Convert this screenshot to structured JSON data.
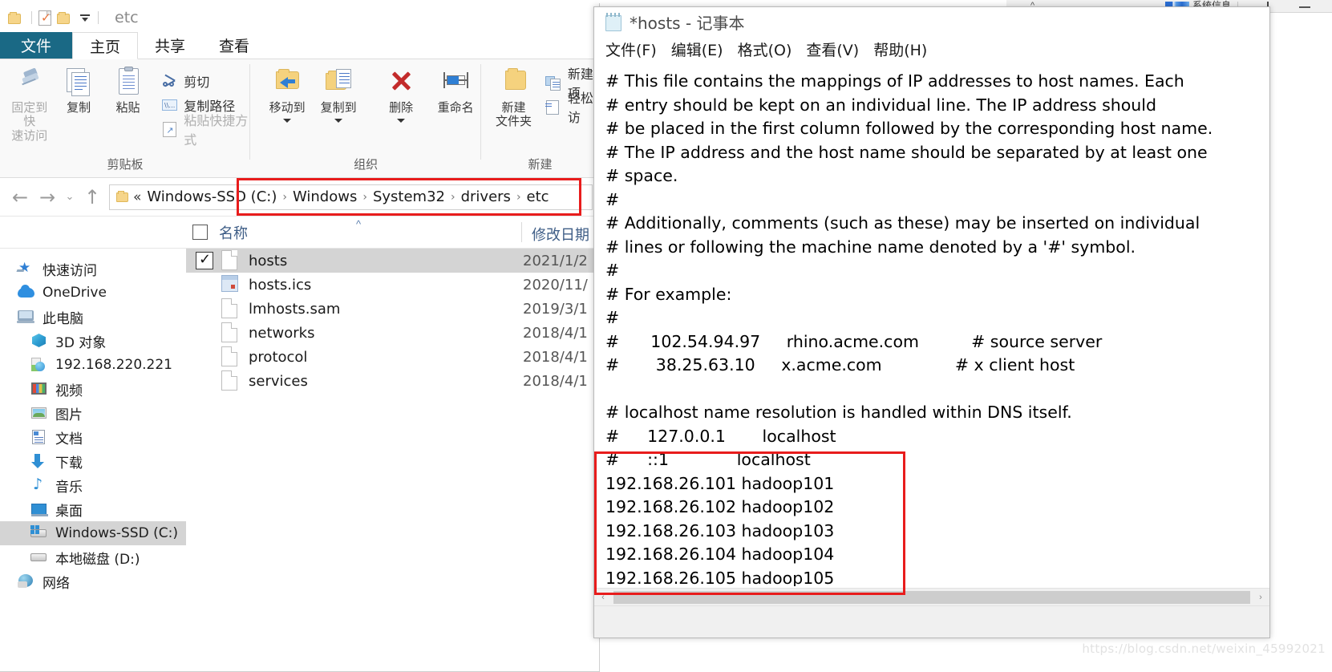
{
  "background_window": {
    "label": "系统信息"
  },
  "explorer": {
    "quick_access_toolbar": {
      "title": "etc",
      "buttons": [
        "folder-icon",
        "properties-icon",
        "new-folder-icon",
        "customize-caret"
      ]
    },
    "ribbon_tabs": [
      {
        "label": "文件",
        "active": false,
        "file_tab": true
      },
      {
        "label": "主页",
        "active": true
      },
      {
        "label": "共享",
        "active": false
      },
      {
        "label": "查看",
        "active": false
      }
    ],
    "ribbon_groups": [
      {
        "name": "剪贴板",
        "big_buttons": [
          {
            "label": "固定到快\n速访问",
            "icon": "pin-icon",
            "disabled": true
          },
          {
            "label": "复制",
            "icon": "copy-icon",
            "disabled": false
          },
          {
            "label": "粘贴",
            "icon": "paste-icon",
            "disabled": false
          }
        ],
        "small_buttons": [
          {
            "label": "剪切",
            "icon": "scissors-icon",
            "disabled": false
          },
          {
            "label": "复制路径",
            "icon": "copy-path-icon",
            "disabled": false
          },
          {
            "label": "粘贴快捷方式",
            "icon": "paste-shortcut-icon",
            "disabled": true
          }
        ]
      },
      {
        "name": "组织",
        "big_buttons": [
          {
            "label": "移动到",
            "icon": "move-to-icon",
            "has_caret": true
          },
          {
            "label": "复制到",
            "icon": "copy-to-icon",
            "has_caret": true
          },
          {
            "label": "删除",
            "icon": "delete-icon",
            "has_caret": true
          },
          {
            "label": "重命名",
            "icon": "rename-icon",
            "has_caret": false
          }
        ]
      },
      {
        "name": "新建",
        "big_buttons": [
          {
            "label": "新建\n文件夹",
            "icon": "new-folder-icon"
          }
        ],
        "small_buttons": [
          {
            "label": "新建项",
            "icon": "new-item-icon"
          },
          {
            "label": "轻松访",
            "icon": "easy-access-icon"
          }
        ]
      }
    ],
    "address_bar": {
      "back_icon": "←",
      "forward_icon": "→",
      "recent_caret": "⌄",
      "up_icon": "↑",
      "lead": "«",
      "crumbs": [
        "Windows-SSD (C:)",
        "Windows",
        "System32",
        "drivers",
        "etc"
      ],
      "separator": "›"
    },
    "columns": {
      "name": "名称",
      "date_modified": "修改日期"
    },
    "nav_pane": [
      {
        "label": "快速访问",
        "icon": "star-icon",
        "indent": false,
        "selected": false
      },
      {
        "label": "OneDrive",
        "icon": "cloud-icon",
        "indent": false,
        "selected": false
      },
      {
        "label": "此电脑",
        "icon": "pc-icon",
        "indent": false,
        "selected": false
      },
      {
        "label": "3D 对象",
        "icon": "cube-icon",
        "indent": true,
        "selected": false
      },
      {
        "label": "192.168.220.221",
        "icon": "network-location-icon",
        "indent": true,
        "selected": false
      },
      {
        "label": "视频",
        "icon": "video-icon",
        "indent": true,
        "selected": false
      },
      {
        "label": "图片",
        "icon": "pictures-icon",
        "indent": true,
        "selected": false
      },
      {
        "label": "文档",
        "icon": "documents-icon",
        "indent": true,
        "selected": false
      },
      {
        "label": "下载",
        "icon": "downloads-icon",
        "indent": true,
        "selected": false
      },
      {
        "label": "音乐",
        "icon": "music-icon",
        "indent": true,
        "selected": false
      },
      {
        "label": "桌面",
        "icon": "desktop-icon",
        "indent": true,
        "selected": false
      },
      {
        "label": "Windows-SSD (C:)",
        "icon": "windows-drive-icon",
        "indent": true,
        "selected": true
      },
      {
        "label": "本地磁盘 (D:)",
        "icon": "hard-disk-icon",
        "indent": true,
        "selected": false
      },
      {
        "label": "网络",
        "icon": "network-icon",
        "indent": false,
        "selected": false
      }
    ],
    "files": [
      {
        "name": "hosts",
        "date": "2021/1/2",
        "icon": "file-icon",
        "selected": true,
        "checked": true
      },
      {
        "name": "hosts.ics",
        "date": "2020/11/",
        "icon": "ics-file-icon",
        "selected": false,
        "checked": false
      },
      {
        "name": "lmhosts.sam",
        "date": "2019/3/1",
        "icon": "file-icon",
        "selected": false,
        "checked": false
      },
      {
        "name": "networks",
        "date": "2018/4/1",
        "icon": "file-icon",
        "selected": false,
        "checked": false
      },
      {
        "name": "protocol",
        "date": "2018/4/1",
        "icon": "file-icon",
        "selected": false,
        "checked": false
      },
      {
        "name": "services",
        "date": "2018/4/1",
        "icon": "file-icon",
        "selected": false,
        "checked": false
      }
    ]
  },
  "notepad": {
    "title": "*hosts - 记事本",
    "icon": "notepad-icon",
    "menu": [
      "文件(F)",
      "编辑(E)",
      "格式(O)",
      "查看(V)",
      "帮助(H)"
    ],
    "content": "# This file contains the mappings of IP addresses to host names. Each\n# entry should be kept on an individual line. The IP address should\n# be placed in the first column followed by the corresponding host name.\n# The IP address and the host name should be separated by at least one\n# space.\n#\n# Additionally, comments (such as these) may be inserted on individual\n# lines or following the machine name denoted by a '#' symbol.\n#\n# For example:\n#\n#      102.54.94.97     rhino.acme.com          # source server\n#       38.25.63.10     x.acme.com              # x client host\n\n# localhost name resolution is handled within DNS itself.\n#\t127.0.0.1       localhost\n#\t::1             localhost\n192.168.26.101 hadoop101\n192.168.26.102 hadoop102\n192.168.26.103 hadoop103\n192.168.26.104 hadoop104\n192.168.26.105 hadoop105",
    "host_entries": [
      "192.168.26.101 hadoop101",
      "192.168.26.102 hadoop102",
      "192.168.26.103 hadoop103",
      "192.168.26.104 hadoop104",
      "192.168.26.105 hadoop105"
    ],
    "scroll_left_arrow": "‹",
    "scroll_right_arrow": "›"
  },
  "watermark": "https://blog.csdn.net/weixin_45992021",
  "colors": {
    "file_tab": "#1a6985",
    "annotation_red": "#e81c1c",
    "selection_gray": "#d4d4d4",
    "header_blue": "#3e5d86"
  }
}
